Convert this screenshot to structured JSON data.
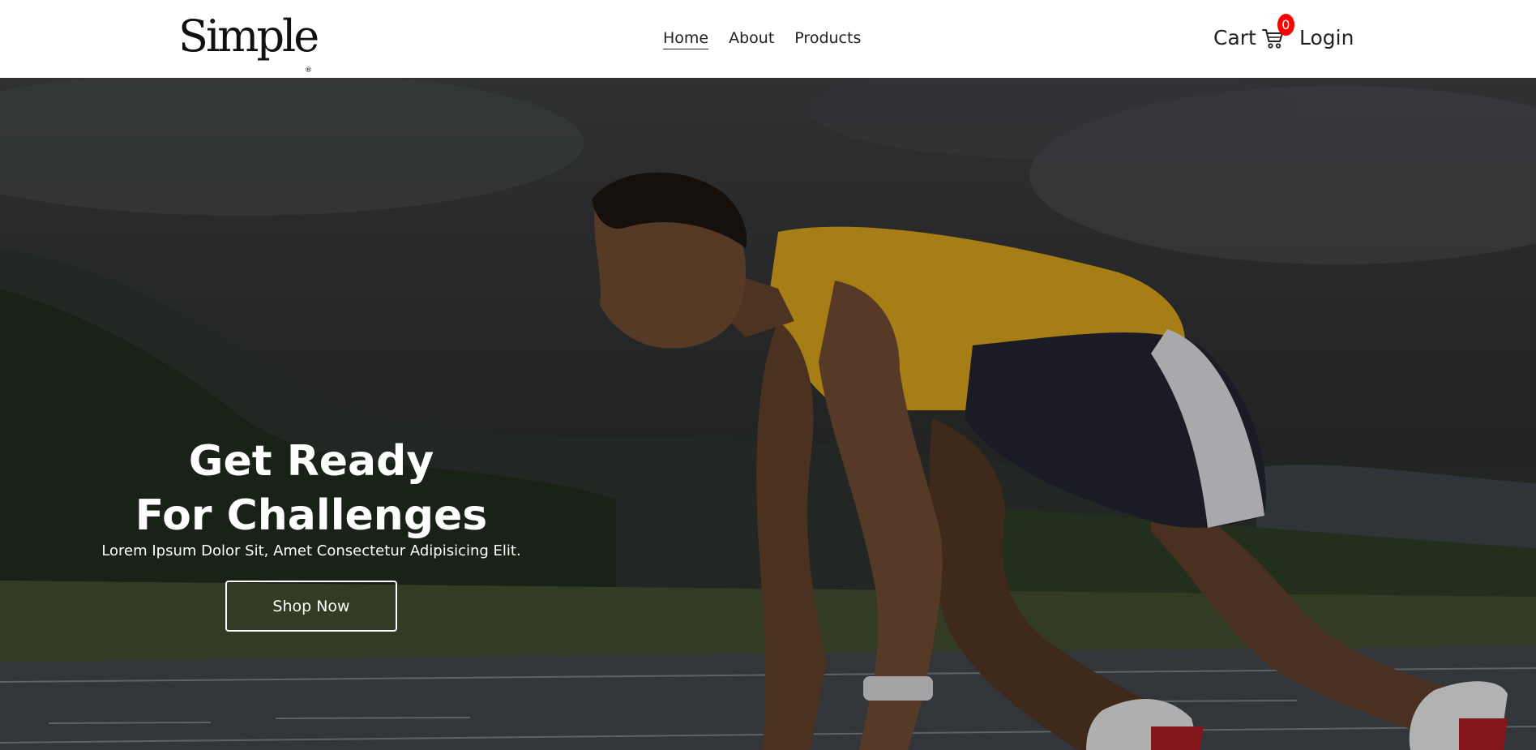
{
  "header": {
    "logo": "Simple",
    "logo_mark": "®",
    "nav": [
      {
        "label": "Home",
        "active": true
      },
      {
        "label": "About",
        "active": false
      },
      {
        "label": "Products",
        "active": false
      }
    ],
    "cart_label": "Cart",
    "cart_count": "0",
    "login_label": "Login"
  },
  "hero": {
    "title_line1": "Get Ready",
    "title_line2": "For Challenges",
    "subtitle": "Lorem Ipsum Dolor Sit, Amet Consectetur Adipisicing Elit.",
    "cta_label": "Shop Now"
  },
  "colors": {
    "badge": "#ff0000",
    "text": "#222222",
    "hero_overlay": "#2b2d2f",
    "jersey": "#d7a616"
  },
  "icons": {
    "cart": "shopping-cart-icon"
  }
}
